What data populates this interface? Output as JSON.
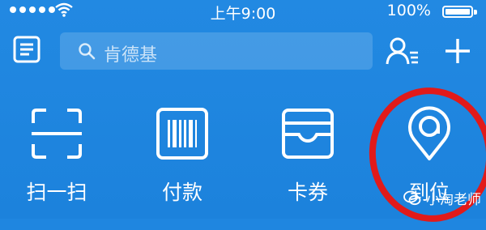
{
  "status_bar": {
    "time": "上午9:00",
    "battery_percent": "100%",
    "signal_bars": 5
  },
  "header": {
    "search": {
      "placeholder": "肯德基"
    },
    "icons": [
      "list-icon",
      "contacts-icon",
      "plus-icon"
    ]
  },
  "actions": [
    {
      "label": "扫一扫",
      "icon": "scan-icon"
    },
    {
      "label": "付款",
      "icon": "barcode-icon"
    },
    {
      "label": "卡券",
      "icon": "card-wallet-icon"
    },
    {
      "label": "到位",
      "icon": "location-pin-icon"
    }
  ],
  "watermark": {
    "text": "小淘老师"
  },
  "colors": {
    "background": "#1f86e0",
    "foreground": "#ffffff",
    "highlight": "#e11a1a"
  }
}
